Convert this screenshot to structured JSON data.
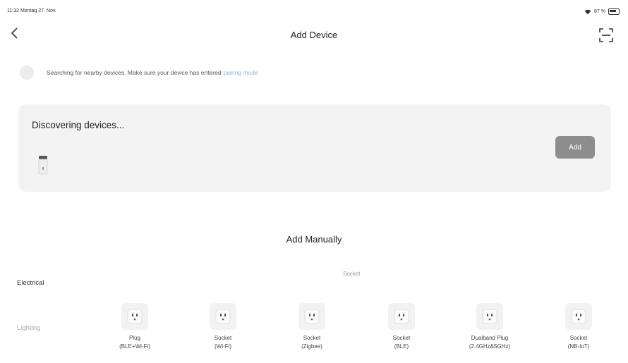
{
  "status_bar": {
    "time_date": "11:32  Montag 27. Nov.",
    "battery": "87 %"
  },
  "nav": {
    "title": "Add Device"
  },
  "search": {
    "text": "Searching for nearby devices. Make sure your device has entered",
    "link": "pairing mode"
  },
  "discover": {
    "title": "Discovering devices...",
    "add_label": "Add"
  },
  "manual": {
    "title": "Add Manually",
    "categories": [
      "Electrical",
      "Lighting"
    ],
    "section_label": "Socket",
    "devices": [
      {
        "line1": "Plug",
        "line2": "(BLE+Wi-Fi)"
      },
      {
        "line1": "Socket",
        "line2": "(Wi-Fi)"
      },
      {
        "line1": "Socket",
        "line2": "(Zigbee)"
      },
      {
        "line1": "Socket",
        "line2": "(BLE)"
      },
      {
        "line1": "Dualband Plug",
        "line2": "(2.4GHz&5GHz)"
      },
      {
        "line1": "Socket",
        "line2": "(NB-IoT)"
      }
    ]
  },
  "colors": {
    "background": "#ffffff",
    "card": "#f3f3f3",
    "add_button": "#8d8d8d",
    "link": "#8fb3d8"
  }
}
